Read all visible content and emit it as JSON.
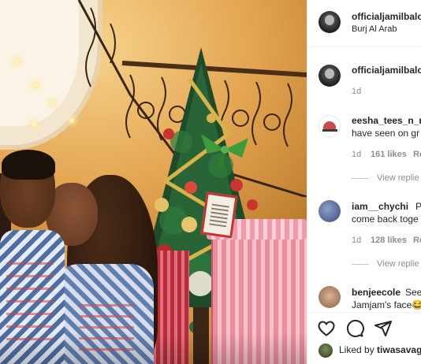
{
  "post": {
    "author": "officialjamilbalo",
    "location": "Burj Al Arab"
  },
  "caption": {
    "author": "officialjamilbalo",
    "time": "1d"
  },
  "comments": [
    {
      "username": "eesha_tees_n_m",
      "text_line1": "",
      "text_line2": "have seen on gr",
      "time": "1d",
      "likes": "161 likes",
      "reply": "Re",
      "view_replies": "View replie"
    },
    {
      "username": "iam__chychi",
      "text_line1": "Pl",
      "text_line2": "come back toge",
      "time": "1d",
      "likes": "128 likes",
      "reply": "Re",
      "view_replies": "View replie"
    },
    {
      "username": "benjeecole",
      "text_line1": "See",
      "text_line2": "Jamjam's face😂",
      "time": "",
      "likes": "",
      "reply": "",
      "view_replies": ""
    }
  ],
  "actions": {
    "like_icon": "heart-icon",
    "comment_icon": "comment-icon",
    "share_icon": "share-icon"
  },
  "liked_by": {
    "prefix": "Liked by ",
    "user": "tiwasavag"
  }
}
